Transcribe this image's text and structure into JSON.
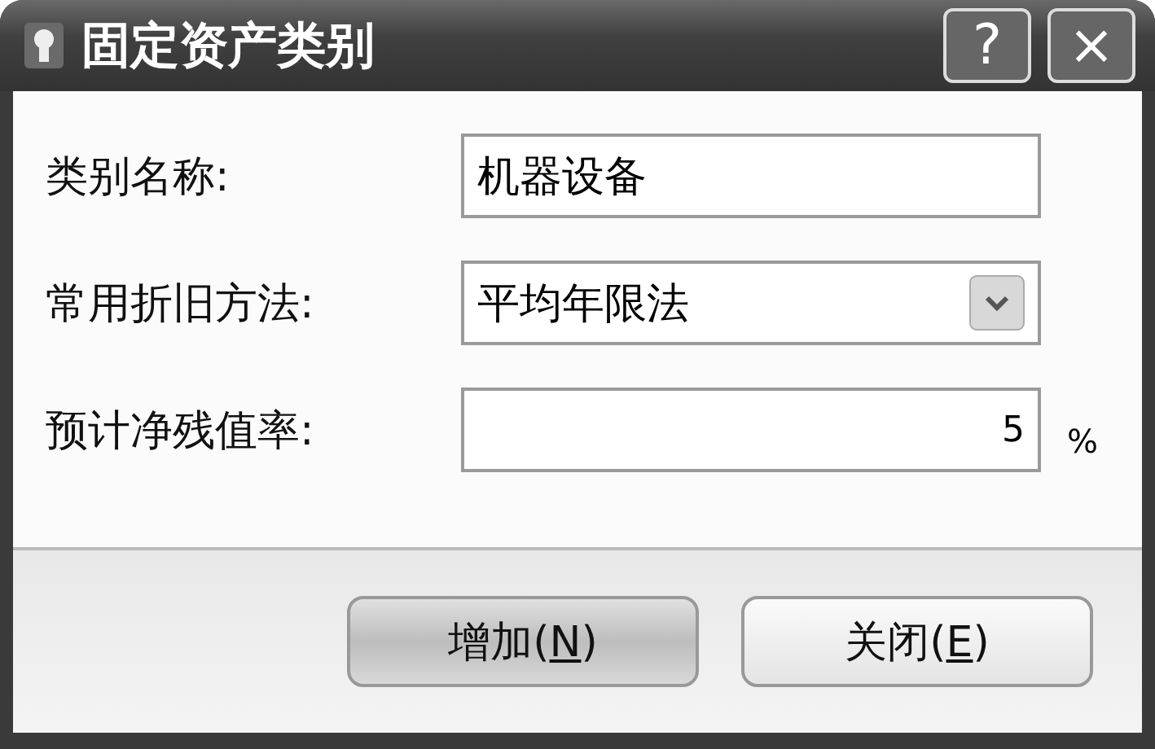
{
  "window": {
    "title": "固定资产类别",
    "title_buttons": [
      "?",
      "×"
    ]
  },
  "fields": [
    {
      "kind": "text",
      "label": "类别名称:",
      "value": "机器设备"
    },
    {
      "kind": "dropdown",
      "label": "常用折旧方法:",
      "value": "平均年限法"
    },
    {
      "kind": "percent",
      "label": "预计净残值率:",
      "value": "5",
      "unit": "%"
    }
  ],
  "buttons": [
    {
      "before": "增加(",
      "key": "N",
      "after": ")",
      "default": true
    },
    {
      "before": "关闭(",
      "key": "E",
      "after": ")",
      "default": false
    }
  ]
}
